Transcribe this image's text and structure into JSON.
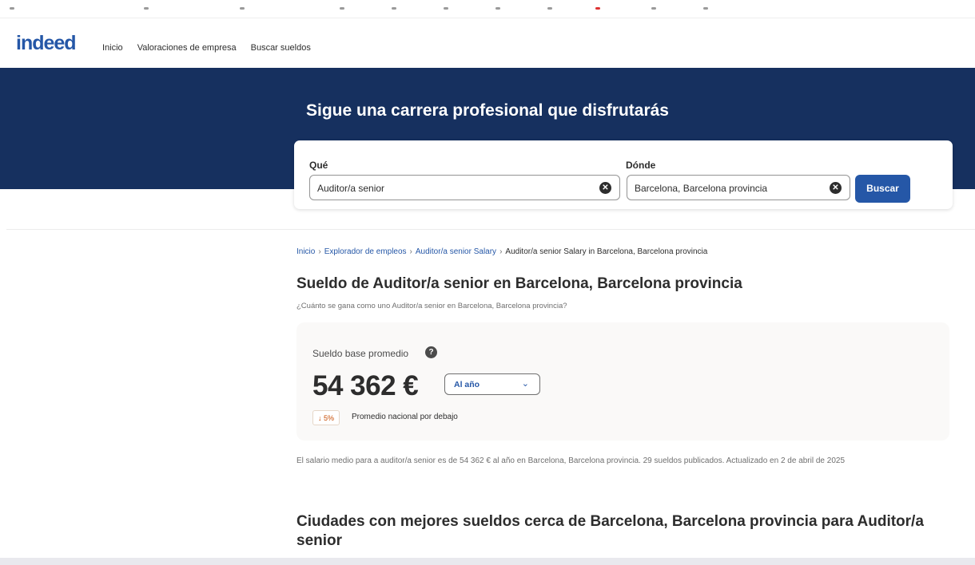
{
  "header": {
    "logo": "indeed",
    "nav": [
      "Inicio",
      "Valoraciones de empresa",
      "Buscar sueldos"
    ]
  },
  "hero": {
    "title": "Sigue una carrera profesional que disfrutarás"
  },
  "search": {
    "what_label": "Qué",
    "what_value": "Auditor/a senior",
    "where_label": "Dónde",
    "where_value": "Barcelona, Barcelona provincia",
    "button_label": "Buscar"
  },
  "breadcrumb": [
    "Inicio",
    "Explorador de empleos",
    "Auditor/a senior Salary",
    "Auditor/a senior Salary in Barcelona, Barcelona provincia"
  ],
  "main": {
    "title": "Sueldo de Auditor/a senior en Barcelona, Barcelona provincia",
    "subtitle": "¿Cuánto se gana como uno Auditor/a senior en Barcelona, Barcelona provincia?",
    "salary": {
      "label": "Sueldo base promedio",
      "amount": "54 362 €",
      "period": "Al año",
      "badge": "↓ 5%",
      "badge_text": "Promedio nacional por debajo"
    },
    "description": "El salario medio para a auditor/a senior es de 54 362 € al año en Barcelona, Barcelona provincia.  29 sueldos publicados. Actualizado en 2 de abril de 2025",
    "section_title": "Ciudades con mejores sueldos cerca de Barcelona, Barcelona provincia para Auditor/a senior"
  },
  "colors": {
    "brand": "#2557a7",
    "hero_bg": "#16305f",
    "badge_text": "#c74a00"
  },
  "icons": {
    "clear": "x-circle-icon",
    "help": "question-circle-icon",
    "chevron": "chevron-down-icon"
  }
}
